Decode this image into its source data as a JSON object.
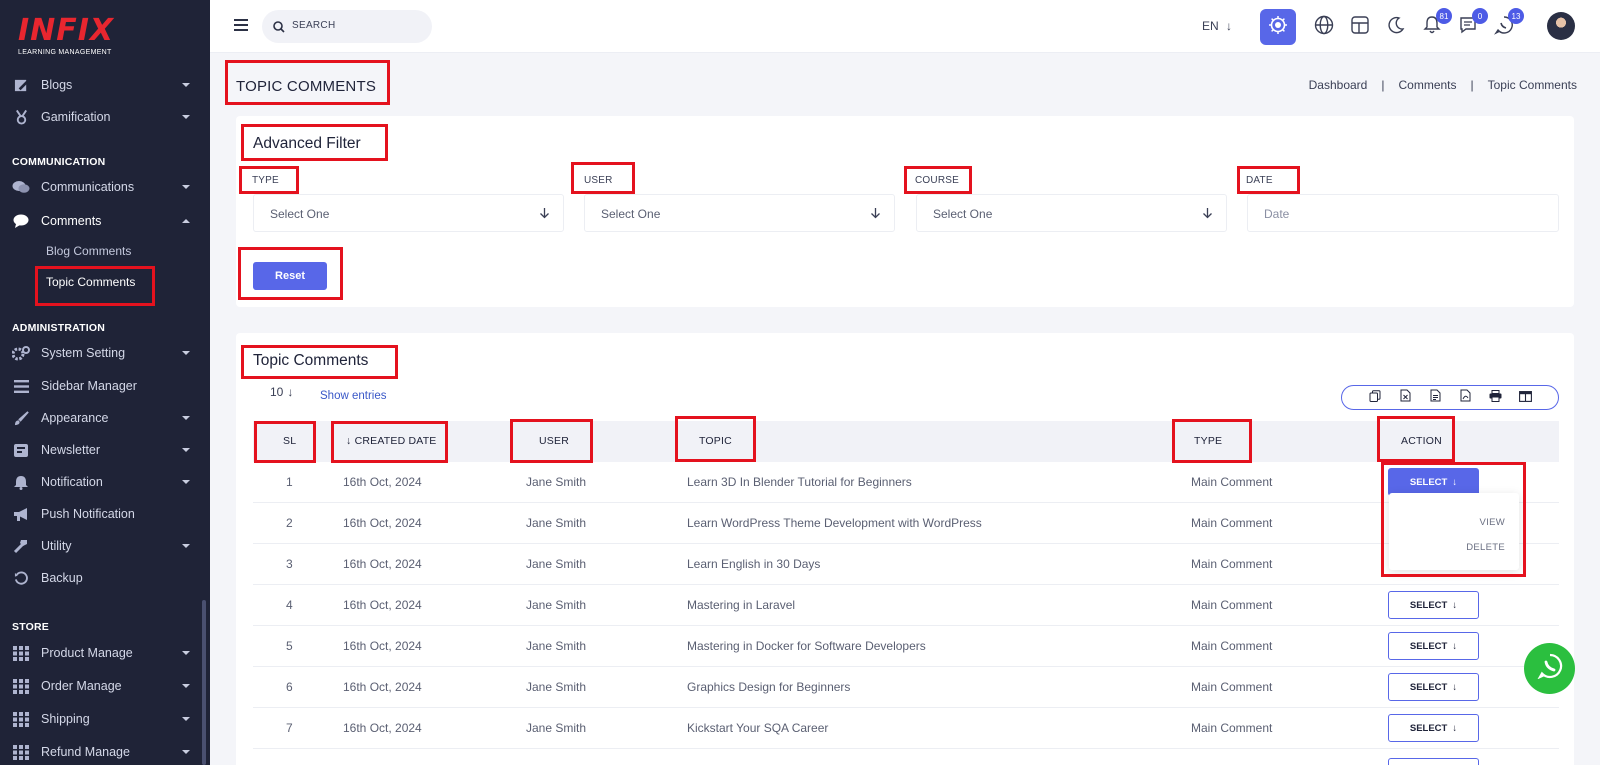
{
  "brand": {
    "logo": "INFIX",
    "subtitle": "LEARNING MANAGEMENT"
  },
  "sidebar": {
    "items": [
      {
        "label": "Blogs",
        "icon": "edit-icon"
      },
      {
        "label": "Gamification",
        "icon": "medal-icon"
      },
      {
        "label": "Communications",
        "icon": "chat-icon"
      },
      {
        "label": "Comments",
        "icon": "comment-icon"
      },
      {
        "label": "System Setting",
        "icon": "gears-icon"
      },
      {
        "label": "Sidebar Manager",
        "icon": "list-icon"
      },
      {
        "label": "Appearance",
        "icon": "brush-icon"
      },
      {
        "label": "Newsletter",
        "icon": "newsletter-icon"
      },
      {
        "label": "Notification",
        "icon": "bell-icon"
      },
      {
        "label": "Push Notification",
        "icon": "megaphone-icon"
      },
      {
        "label": "Utility",
        "icon": "hammer-icon"
      },
      {
        "label": "Backup",
        "icon": "history-icon"
      },
      {
        "label": "Product Manage",
        "icon": "grid-icon"
      },
      {
        "label": "Order Manage",
        "icon": "grid-icon"
      },
      {
        "label": "Shipping",
        "icon": "grid-icon"
      },
      {
        "label": "Refund Manage",
        "icon": "grid-icon"
      }
    ],
    "sections": {
      "communication": "COMMUNICATION",
      "administration": "ADMINISTRATION",
      "store": "STORE"
    },
    "subitems": {
      "blog_comments": "Blog Comments",
      "topic_comments": "Topic Comments"
    }
  },
  "topbar": {
    "search_placeholder": "SEARCH",
    "language": "EN",
    "badges": {
      "notifications": "81",
      "messages": "0",
      "chats": "13"
    }
  },
  "page": {
    "title": "TOPIC COMMENTS",
    "breadcrumb": [
      "Dashboard",
      "Comments",
      "Topic Comments"
    ]
  },
  "filter": {
    "title": "Advanced Filter",
    "fields": [
      {
        "label": "TYPE",
        "value": "Select One"
      },
      {
        "label": "USER",
        "value": "Select One"
      },
      {
        "label": "COURSE",
        "value": "Select One"
      },
      {
        "label": "DATE",
        "value": "Date"
      }
    ],
    "reset_label": "Reset"
  },
  "table": {
    "title": "Topic Comments",
    "page_size": "10",
    "show_entries_label": "Show entries",
    "columns": [
      "SL",
      "CREATED DATE",
      "USER",
      "TOPIC",
      "TYPE",
      "ACTION"
    ],
    "rows": [
      {
        "sl": "1",
        "date": "16th Oct, 2024",
        "user": "Jane Smith",
        "topic": "Learn 3D In Blender Tutorial for Beginners",
        "type": "Main Comment"
      },
      {
        "sl": "2",
        "date": "16th Oct, 2024",
        "user": "Jane Smith",
        "topic": "Learn WordPress Theme Development with WordPress",
        "type": "Main Comment"
      },
      {
        "sl": "3",
        "date": "16th Oct, 2024",
        "user": "Jane Smith",
        "topic": "Learn English in 30 Days",
        "type": "Main Comment"
      },
      {
        "sl": "4",
        "date": "16th Oct, 2024",
        "user": "Jane Smith",
        "topic": "Mastering in Laravel",
        "type": "Main Comment"
      },
      {
        "sl": "5",
        "date": "16th Oct, 2024",
        "user": "Jane Smith",
        "topic": "Mastering in Docker for Software Developers",
        "type": "Main Comment"
      },
      {
        "sl": "6",
        "date": "16th Oct, 2024",
        "user": "Jane Smith",
        "topic": "Graphics Design for Beginners",
        "type": "Main Comment"
      },
      {
        "sl": "7",
        "date": "16th Oct, 2024",
        "user": "Jane Smith",
        "topic": "Kickstart Your SQA Career",
        "type": "Main Comment"
      }
    ],
    "select_label": "SELECT",
    "dropdown": [
      "VIEW",
      "DELETE"
    ]
  },
  "colors": {
    "accent": "#5867e8",
    "sidebar": "#1f2337",
    "highlight": "#e4121e",
    "whatsapp": "#2bbf3f"
  }
}
